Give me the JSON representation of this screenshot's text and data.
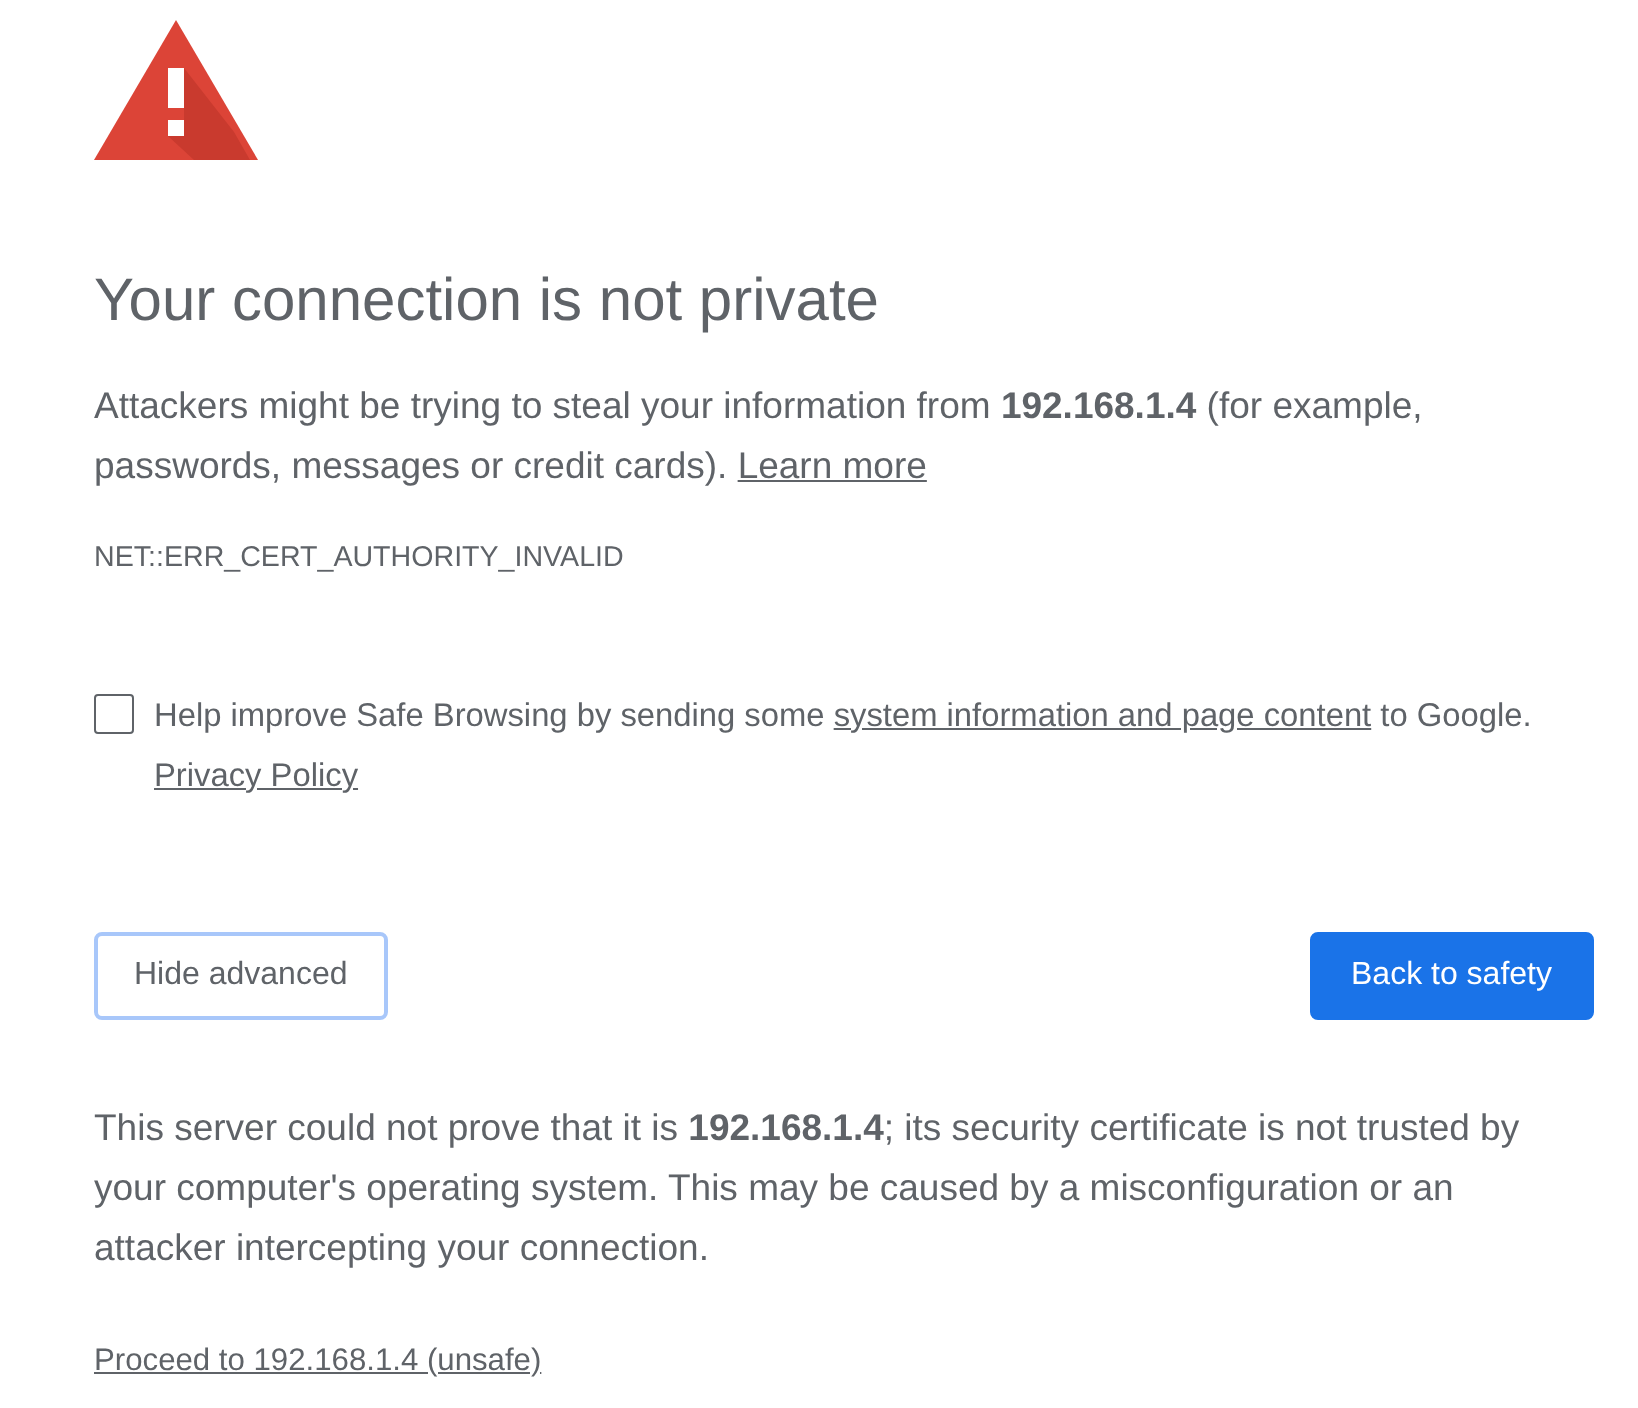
{
  "heading": "Your connection is not private",
  "intro": {
    "text": "Attackers might be trying to steal your information from **192.168.1.4** (for example, passwords, messages or credit cards).",
    "link": "Learn more"
  },
  "error_code": "NET::ERR_CERT_AUTHORITY_INVALID",
  "safe_browsing": {
    "checked": false,
    "text_before": "Help improve Safe Browsing by sending some",
    "link": "system information and page content",
    "text_after": "to Google.",
    "policy_link": "Privacy Policy"
  },
  "buttons": [
    {
      "label": "Hide advanced",
      "kind": "secondary"
    },
    {
      "label": "Back to safety",
      "kind": "primary"
    }
  ],
  "details": "This server could not prove that it is **192.168.1.4**; its security certificate is not trusted by your computer's operating system. This may be caused by a misconfiguration or an attacker intercepting your connection.",
  "proceed_link": "Proceed to 192.168.1.4 (unsafe)"
}
